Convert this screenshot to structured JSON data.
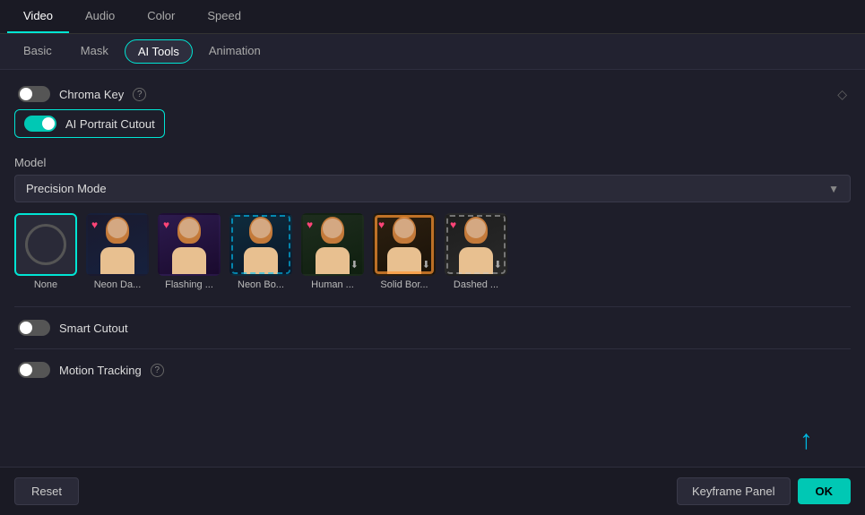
{
  "topTabs": [
    {
      "id": "video",
      "label": "Video",
      "active": true
    },
    {
      "id": "audio",
      "label": "Audio",
      "active": false
    },
    {
      "id": "color",
      "label": "Color",
      "active": false
    },
    {
      "id": "speed",
      "label": "Speed",
      "active": false
    }
  ],
  "subTabs": [
    {
      "id": "basic",
      "label": "Basic",
      "active": false
    },
    {
      "id": "mask",
      "label": "Mask",
      "active": false
    },
    {
      "id": "ai-tools",
      "label": "AI Tools",
      "active": true
    },
    {
      "id": "animation",
      "label": "Animation",
      "active": false
    }
  ],
  "chromaKey": {
    "label": "Chroma Key",
    "enabled": false
  },
  "aiPortraitCutout": {
    "label": "AI Portrait Cutout",
    "enabled": true
  },
  "model": {
    "label": "Model",
    "selected": "Precision Mode"
  },
  "effects": [
    {
      "id": "none",
      "name": "None",
      "type": "none",
      "selected": true,
      "heart": false
    },
    {
      "id": "neon-da",
      "name": "Neon Da...",
      "type": "neon-dark",
      "selected": false,
      "heart": true,
      "download": false
    },
    {
      "id": "flashing",
      "name": "Flashing ...",
      "type": "flashing",
      "selected": false,
      "heart": true,
      "download": false
    },
    {
      "id": "neon-bo",
      "name": "Neon Bo...",
      "type": "neon-border",
      "selected": false,
      "heart": false,
      "download": false
    },
    {
      "id": "human",
      "name": "Human ...",
      "type": "human",
      "selected": false,
      "heart": true,
      "download": false
    },
    {
      "id": "solid-bor",
      "name": "Solid Bor...",
      "type": "solid",
      "selected": false,
      "heart": true,
      "download": false
    },
    {
      "id": "dashed",
      "name": "Dashed ...",
      "type": "dashed",
      "selected": false,
      "heart": true,
      "download": true
    }
  ],
  "smartCutout": {
    "label": "Smart Cutout",
    "enabled": false
  },
  "motionTracking": {
    "label": "Motion Tracking",
    "enabled": false
  },
  "bottomBar": {
    "resetLabel": "Reset",
    "keyframePanelLabel": "Keyframe Panel",
    "okLabel": "OK"
  }
}
